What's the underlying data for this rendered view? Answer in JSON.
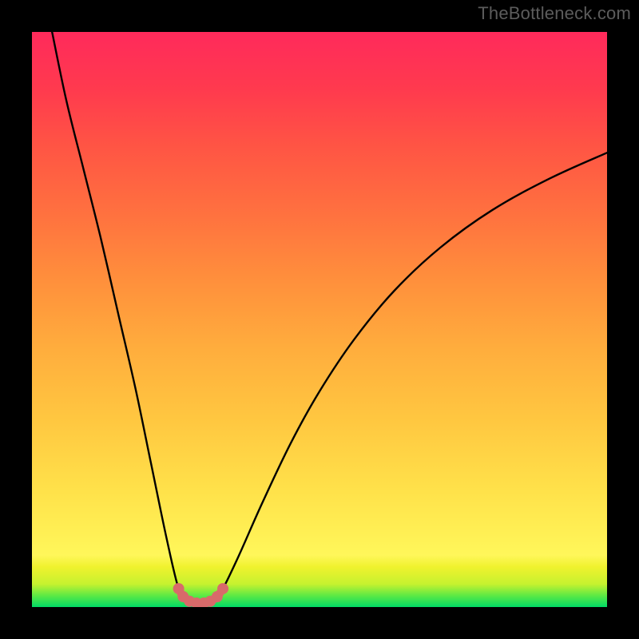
{
  "watermark": "TheBottleneck.com",
  "chart_data": {
    "type": "line",
    "title": "",
    "xlabel": "",
    "ylabel": "",
    "xlim": [
      0,
      100
    ],
    "ylim": [
      0,
      100
    ],
    "series": [
      {
        "name": "curve",
        "color": "#000000",
        "points": [
          {
            "x": 3.5,
            "y": 100
          },
          {
            "x": 6,
            "y": 88
          },
          {
            "x": 9,
            "y": 76
          },
          {
            "x": 12,
            "y": 64
          },
          {
            "x": 15,
            "y": 51
          },
          {
            "x": 18,
            "y": 38
          },
          {
            "x": 20.7,
            "y": 25
          },
          {
            "x": 23.4,
            "y": 12
          },
          {
            "x": 25.5,
            "y": 3.2
          },
          {
            "x": 27,
            "y": 1.1
          },
          {
            "x": 28.6,
            "y": 0.7
          },
          {
            "x": 30.2,
            "y": 0.8
          },
          {
            "x": 31.8,
            "y": 1.4
          },
          {
            "x": 33.2,
            "y": 3.2
          },
          {
            "x": 36,
            "y": 9
          },
          {
            "x": 40,
            "y": 18
          },
          {
            "x": 45,
            "y": 28.5
          },
          {
            "x": 50,
            "y": 37.5
          },
          {
            "x": 56,
            "y": 46.5
          },
          {
            "x": 63,
            "y": 55
          },
          {
            "x": 71,
            "y": 62.5
          },
          {
            "x": 80,
            "y": 69
          },
          {
            "x": 90,
            "y": 74.5
          },
          {
            "x": 100,
            "y": 79
          }
        ]
      },
      {
        "name": "highlight",
        "color": "#d86a6a",
        "points": [
          {
            "x": 25.5,
            "y": 3.2
          },
          {
            "x": 26.3,
            "y": 1.8
          },
          {
            "x": 27.4,
            "y": 1.0
          },
          {
            "x": 28.6,
            "y": 0.7
          },
          {
            "x": 29.9,
            "y": 0.7
          },
          {
            "x": 31.0,
            "y": 1.0
          },
          {
            "x": 32.2,
            "y": 1.8
          },
          {
            "x": 33.2,
            "y": 3.2
          }
        ]
      }
    ],
    "gradient_stops": [
      {
        "pos": 0,
        "color": "#00db66"
      },
      {
        "pos": 2,
        "color": "#5de944"
      },
      {
        "pos": 4,
        "color": "#c6f22f"
      },
      {
        "pos": 7,
        "color": "#f0f22e"
      },
      {
        "pos": 9,
        "color": "#fff75a"
      },
      {
        "pos": 20,
        "color": "#ffe24a"
      },
      {
        "pos": 33,
        "color": "#ffc640"
      },
      {
        "pos": 45,
        "color": "#ffad3d"
      },
      {
        "pos": 57,
        "color": "#ff8f3c"
      },
      {
        "pos": 68,
        "color": "#ff723f"
      },
      {
        "pos": 80,
        "color": "#ff5544"
      },
      {
        "pos": 90,
        "color": "#ff3a4e"
      },
      {
        "pos": 100,
        "color": "#ff2a5b"
      }
    ]
  }
}
